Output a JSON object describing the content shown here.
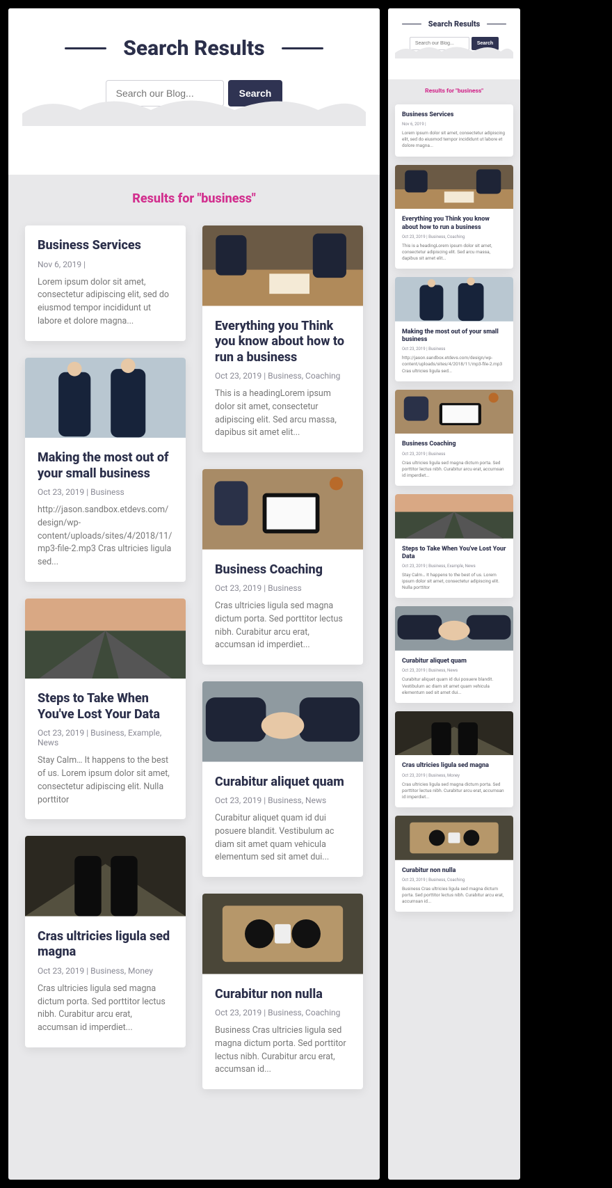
{
  "header": {
    "title": "Search Results",
    "search_placeholder": "Search our Blog...",
    "search_button": "Search"
  },
  "results_heading": "Results for \"business\"",
  "posts": [
    {
      "title": "Business Services",
      "date": "Nov 6, 2019",
      "categories": "",
      "excerpt": "Lorem ipsum dolor sit amet, consectetur adipiscing elit, sed do eiusmod tempor incididunt ut labore et dolore magna...",
      "has_image": false
    },
    {
      "title": "Everything you Think you know about how to run a business",
      "date": "Oct 23, 2019",
      "categories": "Business, Coaching",
      "excerpt": "This is a headingLorem ipsum dolor sit amet, consectetur adipiscing elit. Sed arcu massa, dapibus sit amet elit...",
      "has_image": true,
      "image": "meeting"
    },
    {
      "title": "Making the most out of your small business",
      "date": "Oct 23, 2019",
      "categories": "Business",
      "excerpt": "http://jason.sandbox.etdevs.com/design/wp-content/uploads/sites/4/2018/11/mp3-file-2.mp3 Cras ultricies ligula sed...",
      "has_image": true,
      "image": "walking"
    },
    {
      "title": "Business Coaching",
      "date": "Oct 23, 2019",
      "categories": "Business",
      "excerpt": "Cras ultricies ligula sed magna dictum porta. Sed porttitor lectus nibh. Curabitur arcu erat, accumsan id imperdiet...",
      "has_image": true,
      "image": "tablet"
    },
    {
      "title": "Steps to Take When You've Lost Your Data",
      "date": "Oct 23, 2019",
      "categories": "Business, Example, News",
      "excerpt": "Stay Calm… It happens to the best of us. Lorem ipsum dolor sit amet, consectetur adipiscing elit. Nulla porttitor",
      "has_image": true,
      "image": "highway"
    },
    {
      "title": "Curabitur aliquet quam",
      "date": "Oct 23, 2019",
      "categories": "Business, News",
      "excerpt": "Curabitur aliquet quam id dui posuere blandit. Vestibulum ac diam sit amet quam vehicula elementum sed sit amet dui...",
      "has_image": true,
      "image": "handshake"
    },
    {
      "title": "Cras ultricies ligula sed magna",
      "date": "Oct 23, 2019",
      "categories": "Business, Money",
      "excerpt": "Cras ultricies ligula sed magna dictum porta. Sed porttitor lectus nibh. Curabitur arcu erat, accumsan id imperdiet...",
      "has_image": true,
      "image": "hallway"
    },
    {
      "title": "Curabitur non nulla",
      "date": "Oct 23, 2019",
      "categories": "Business, Coaching",
      "excerpt": "Business Cras ultricies ligula sed magna dictum porta. Sed porttitor lectus nibh. Curabitur arcu erat, accumsan id...",
      "has_image": true,
      "image": "topdown"
    }
  ],
  "desktop_order": [
    0,
    1,
    2,
    3,
    4,
    5,
    6,
    7
  ],
  "desktop_left": [
    0,
    2,
    4,
    6
  ],
  "desktop_right": [
    1,
    3,
    5,
    7
  ]
}
